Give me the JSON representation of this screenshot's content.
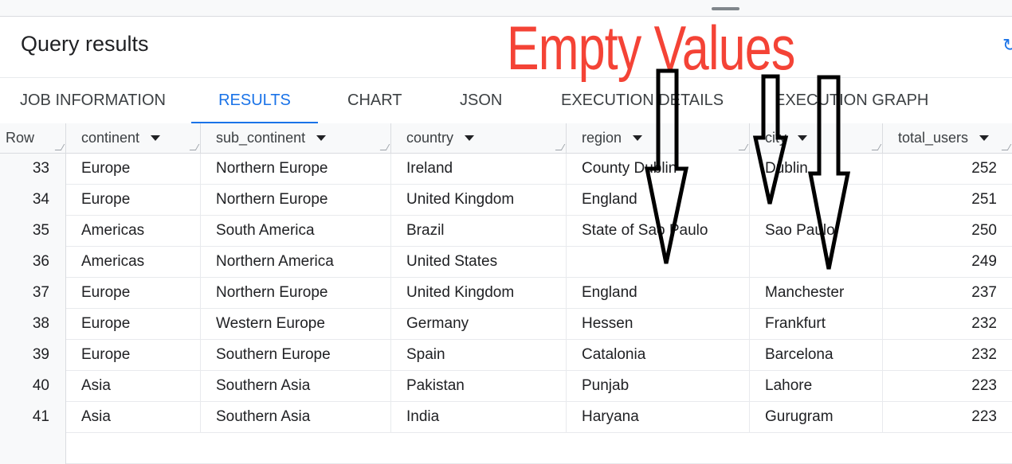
{
  "panel": {
    "title": "Query results"
  },
  "tabs": [
    {
      "label": "JOB INFORMATION",
      "active": false
    },
    {
      "label": "RESULTS",
      "active": true
    },
    {
      "label": "CHART",
      "active": false
    },
    {
      "label": "JSON",
      "active": false
    },
    {
      "label": "EXECUTION DETAILS",
      "active": false
    },
    {
      "label": "EXECUTION GRAPH",
      "active": false
    }
  ],
  "table": {
    "columns": [
      "Row",
      "continent",
      "sub_continent",
      "country",
      "region",
      "city",
      "total_users"
    ],
    "rows": [
      {
        "row": "33",
        "continent": "Europe",
        "sub_continent": "Northern Europe",
        "country": "Ireland",
        "region": "County Dublin",
        "city": "Dublin",
        "total_users": "252"
      },
      {
        "row": "34",
        "continent": "Europe",
        "sub_continent": "Northern Europe",
        "country": "United Kingdom",
        "region": "England",
        "city": "",
        "total_users": "251"
      },
      {
        "row": "35",
        "continent": "Americas",
        "sub_continent": "South America",
        "country": "Brazil",
        "region": "State of Sao Paulo",
        "city": "Sao Paulo",
        "total_users": "250"
      },
      {
        "row": "36",
        "continent": "Americas",
        "sub_continent": "Northern America",
        "country": "United States",
        "region": "",
        "city": "",
        "total_users": "249"
      },
      {
        "row": "37",
        "continent": "Europe",
        "sub_continent": "Northern Europe",
        "country": "United Kingdom",
        "region": "England",
        "city": "Manchester",
        "total_users": "237"
      },
      {
        "row": "38",
        "continent": "Europe",
        "sub_continent": "Western Europe",
        "country": "Germany",
        "region": "Hessen",
        "city": "Frankfurt",
        "total_users": "232"
      },
      {
        "row": "39",
        "continent": "Europe",
        "sub_continent": "Southern Europe",
        "country": "Spain",
        "region": "Catalonia",
        "city": "Barcelona",
        "total_users": "232"
      },
      {
        "row": "40",
        "continent": "Asia",
        "sub_continent": "Southern Asia",
        "country": "Pakistan",
        "region": "Punjab",
        "city": "Lahore",
        "total_users": "223"
      },
      {
        "row": "41",
        "continent": "Asia",
        "sub_continent": "Southern Asia",
        "country": "India",
        "region": "Haryana",
        "city": "Gurugram",
        "total_users": "223"
      }
    ]
  },
  "annotation": {
    "text": "Empty Values",
    "color": "#f44336"
  },
  "icons": {
    "refresh": "refresh-icon",
    "sort": "caret-down-icon",
    "resize": "resize-grip-icon"
  },
  "colors": {
    "accent": "#1a73e8",
    "header_bg": "#f8f9fa"
  }
}
